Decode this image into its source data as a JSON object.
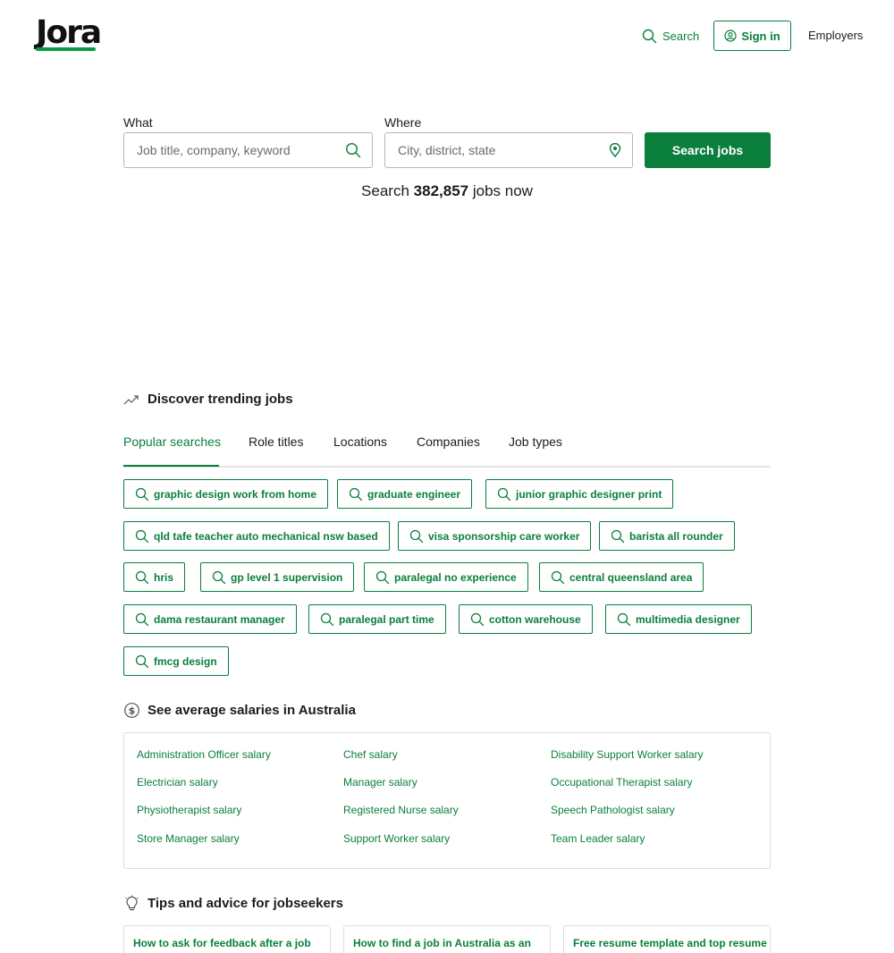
{
  "header": {
    "logo_text": "Jora",
    "nav_search": "Search",
    "nav_signin": "Sign in",
    "nav_employers": "Employers"
  },
  "search": {
    "what_label": "What",
    "what_placeholder": "Job title, company, keyword",
    "where_label": "Where",
    "where_placeholder": "City, district, state",
    "button": "Search jobs",
    "count_prefix": "Search",
    "count": "382,857",
    "count_suffix": "jobs now"
  },
  "trending": {
    "heading": "Discover trending jobs",
    "tabs": [
      "Popular searches",
      "Role titles",
      "Locations",
      "Companies",
      "Job types"
    ],
    "chips": [
      "graphic design work from home",
      "graduate engineer",
      "junior graphic designer print",
      "qld tafe teacher auto mechanical nsw based",
      "visa sponsorship care worker",
      "barista all rounder",
      "hris",
      "gp level 1 supervision",
      "paralegal no experience",
      "central queensland area",
      "dama restaurant manager",
      "paralegal part time",
      "cotton warehouse",
      "multimedia designer",
      "fmcg design"
    ]
  },
  "salaries": {
    "heading": "See average salaries in Australia",
    "links": [
      "Administration Officer salary",
      "Chef salary",
      "Disability Support Worker salary",
      "Electrician salary",
      "Manager salary",
      "Occupational Therapist salary",
      "Physiotherapist salary",
      "Registered Nurse salary",
      "Speech Pathologist salary",
      "Store Manager salary",
      "Support Worker salary",
      "Team Leader salary"
    ]
  },
  "tips": {
    "heading": "Tips and advice for jobseekers",
    "cards": [
      "How to ask for feedback after a job",
      "How to find a job in Australia as an",
      "Free resume template and top resume"
    ]
  },
  "colors": {
    "brand_green": "#0a7f3c",
    "logo_bar": "#0a9945"
  }
}
